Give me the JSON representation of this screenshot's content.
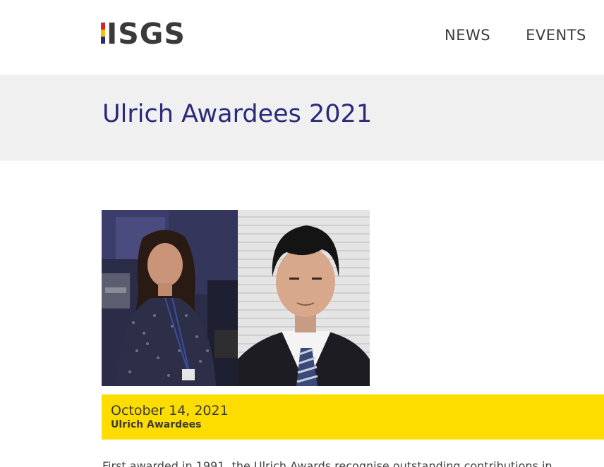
{
  "header": {
    "logo_text": "ISGS",
    "logo_colors": [
      "#d8262c",
      "#f4c300",
      "#2b2a7a"
    ],
    "nav": [
      {
        "label": "NEWS"
      },
      {
        "label": "EVENTS"
      }
    ]
  },
  "page": {
    "title": "Ulrich Awardees 2021"
  },
  "post": {
    "date": "October 14, 2021",
    "category": "Ulrich Awardees",
    "intro": "First awarded in 1991, the Ulrich Awards recognise outstanding contributions in"
  },
  "colors": {
    "title": "#2b2a7a",
    "band": "#f0f0f0",
    "info_bar": "#fddd00",
    "text": "#3a3a3a"
  }
}
